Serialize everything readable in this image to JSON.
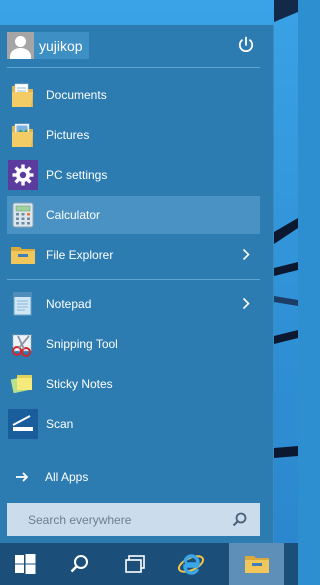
{
  "user": {
    "name": "yujikop"
  },
  "pinned": [
    {
      "label": "Documents",
      "icon": "documents-folder-icon"
    },
    {
      "label": "Pictures",
      "icon": "pictures-folder-icon"
    },
    {
      "label": "PC settings",
      "icon": "gear-icon"
    },
    {
      "label": "Calculator",
      "icon": "calculator-icon",
      "active": true
    },
    {
      "label": "File Explorer",
      "icon": "file-explorer-icon",
      "has_submenu": true
    }
  ],
  "recent": [
    {
      "label": "Notepad",
      "icon": "notepad-icon",
      "has_submenu": true
    },
    {
      "label": "Snipping Tool",
      "icon": "scissors-icon"
    },
    {
      "label": "Sticky Notes",
      "icon": "sticky-notes-icon"
    },
    {
      "label": "Scan",
      "icon": "scan-icon"
    }
  ],
  "all_apps": {
    "label": "All Apps",
    "icon": "arrow-right-icon"
  },
  "search": {
    "placeholder": "Search everywhere",
    "icon": "search-icon"
  },
  "taskbar": [
    {
      "icon": "windows-start-icon"
    },
    {
      "icon": "search-icon"
    },
    {
      "icon": "task-view-icon"
    },
    {
      "icon": "internet-explorer-icon"
    },
    {
      "icon": "file-explorer-icon",
      "active": true
    }
  ],
  "colors": {
    "menu_bg": "#2c7cb1",
    "highlight": "#4a92c3",
    "taskbar_bg": "#1b4f79",
    "search_bg": "#cbdcec"
  }
}
